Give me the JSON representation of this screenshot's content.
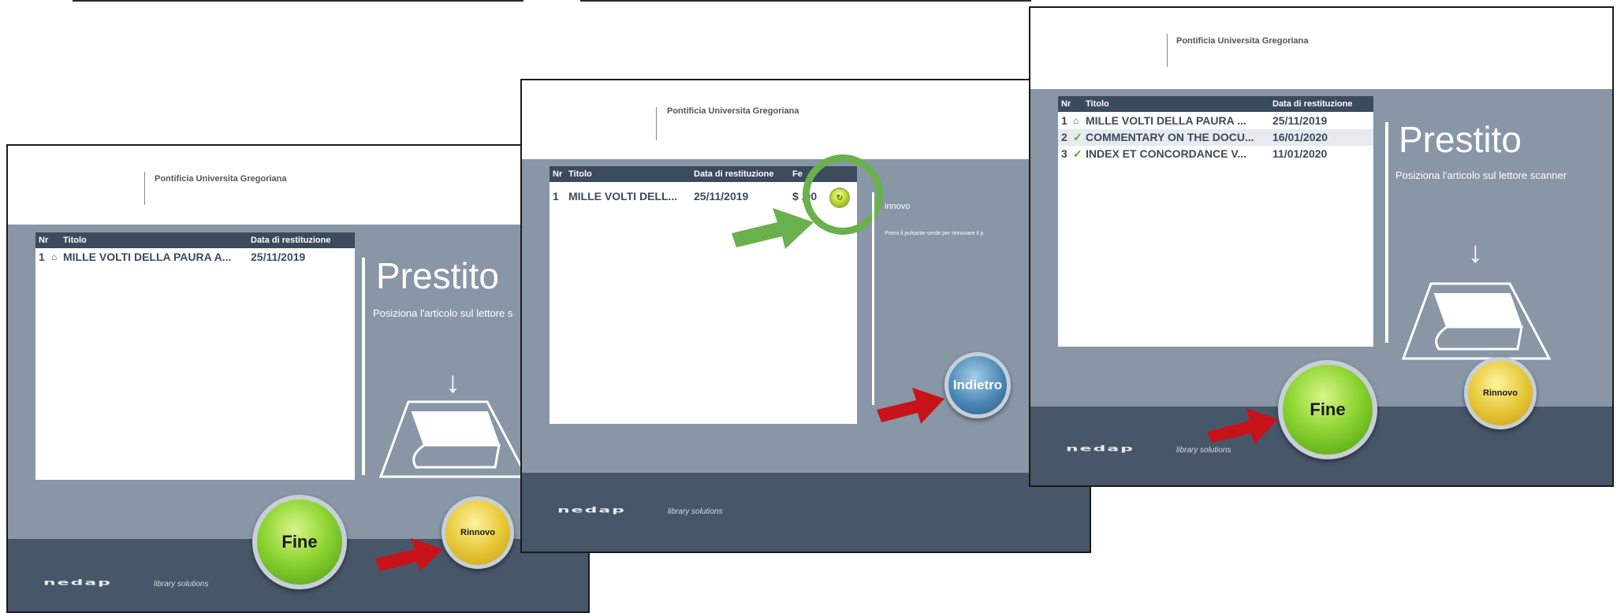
{
  "screens": [
    {
      "org": "Pontificia Universita Gregoriana",
      "columns": [
        "Nr",
        "Titolo",
        "Data di restituzione"
      ],
      "rows": [
        {
          "nr": "1",
          "icon": "house-icon",
          "title": "MILLE VOLTI DELLA PAURA A...",
          "date": "25/11/2019"
        }
      ],
      "heading": "Prestito",
      "instruction": "Posiziona l'articolo sul lettore s",
      "fine_label": "Fine",
      "rinnovo_label": "Rinnovo",
      "brand": "nedap",
      "brand_tagline": "library solutions"
    },
    {
      "org": "Pontificia Universita Gregoriana",
      "columns": [
        "Nr",
        "Titolo",
        "Data di restituzione",
        "Fe"
      ],
      "rows": [
        {
          "nr": "1",
          "title": "MILLE VOLTI DELL...",
          "date": "25/11/2019",
          "fee": "$ ,00"
        }
      ],
      "heading": "innovo",
      "instruction": "Premi il pulsante verde per rinnovare il p",
      "indietro_label": "Indietro",
      "brand": "nedap",
      "brand_tagline": "library solutions"
    },
    {
      "org": "Pontificia Universita Gregoriana",
      "columns": [
        "Nr",
        "Titolo",
        "Data di restituzione"
      ],
      "rows": [
        {
          "nr": "1",
          "icon": "house-icon",
          "title": "MILLE VOLTI DELLA PAURA ...",
          "date": "25/11/2019"
        },
        {
          "nr": "2",
          "icon": "check-icon",
          "title": "COMMENTARY ON THE DOCU...",
          "date": "16/01/2020"
        },
        {
          "nr": "3",
          "icon": "check-icon",
          "title": "INDEX ET CONCORDANCE V...",
          "date": "11/01/2020"
        }
      ],
      "heading": "Prestito",
      "instruction": "Posiziona l'articolo sul lettore scanner",
      "fine_label": "Fine",
      "rinnovo_label": "Rinnovo",
      "brand": "nedap",
      "brand_tagline": "library solutions"
    }
  ],
  "colors": {
    "panel_bg": "#8896a6",
    "footer_bg": "#475669",
    "table_header": "#3b4a5c",
    "highlight_ring": "#6ab04c",
    "callout_arrow_red": "#c8121a",
    "callout_arrow_green": "#6ab04c"
  }
}
